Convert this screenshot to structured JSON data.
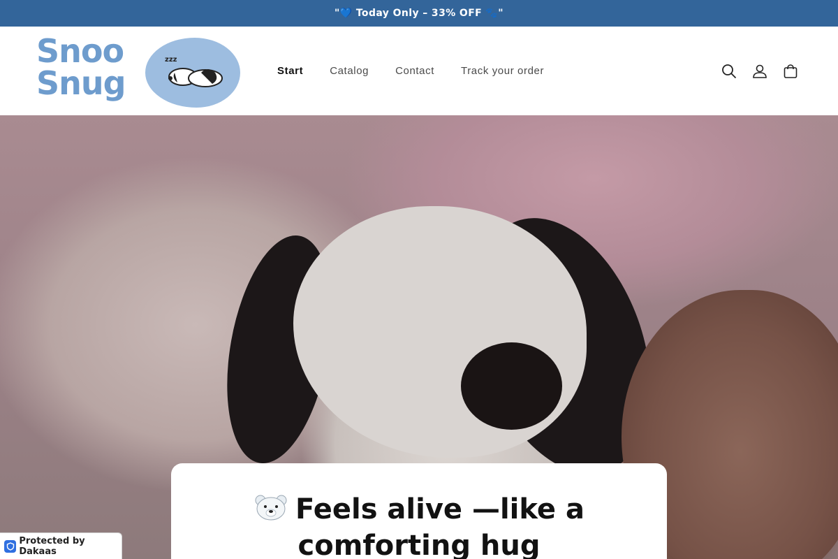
{
  "announcement": {
    "text": "\"💙 Today Only – 33% OFF 🐾\""
  },
  "logo": {
    "line1": "Snoo",
    "line2": "Snug",
    "sleep_marker": "zzz"
  },
  "nav": {
    "items": [
      {
        "label": "Start",
        "active": true
      },
      {
        "label": "Catalog",
        "active": false
      },
      {
        "label": "Contact",
        "active": false
      },
      {
        "label": "Track your order",
        "active": false
      }
    ]
  },
  "header_icons": [
    "search-icon",
    "account-icon",
    "cart-icon"
  ],
  "hero": {
    "emoji": "bear-face-icon",
    "heading_bold": "Feels alive",
    "heading_rest": " —like a comforting hug"
  },
  "badge": {
    "text": "Protected by Dakaas"
  },
  "colors": {
    "announcement_bg": "#33659a",
    "logo_text": "#6e9ccd",
    "logo_blob": "#9dbde0",
    "badge_shield": "#2f6fe0"
  }
}
